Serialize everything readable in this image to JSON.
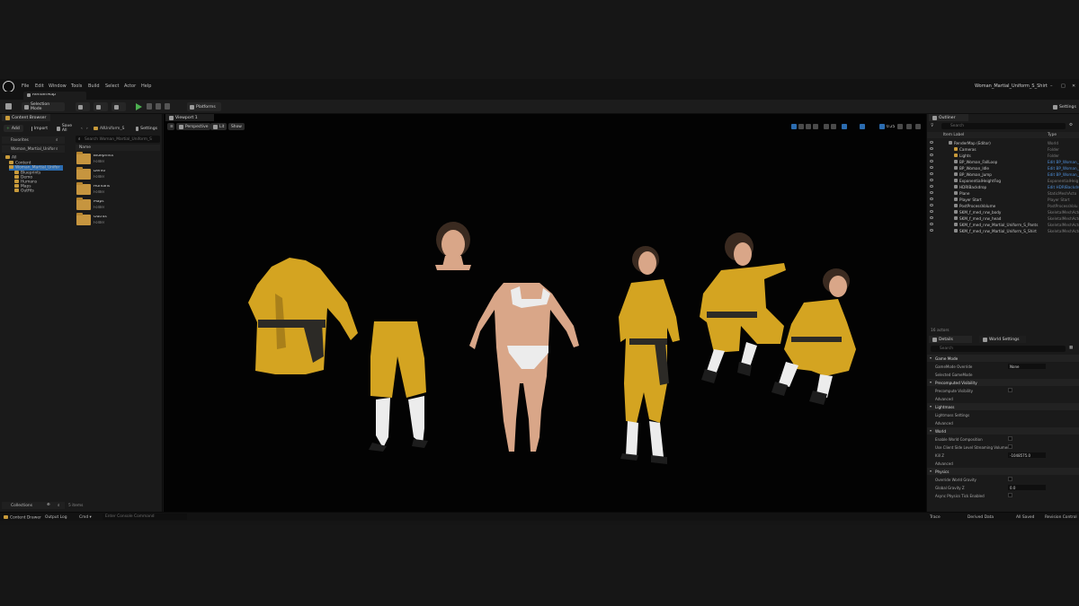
{
  "menu": [
    "File",
    "Edit",
    "Window",
    "Tools",
    "Build",
    "Select",
    "Actor",
    "Help"
  ],
  "map_tab": "RenderMap",
  "window_title": "Woman_Martial_Uniform_S_Shirt",
  "window_controls": [
    "–",
    "□",
    "✕"
  ],
  "toolbar": {
    "mode": "Selection Mode",
    "platforms": "Platforms",
    "settings": "Settings"
  },
  "content_browser": {
    "tab": "Content Browser",
    "add": "Add",
    "import": "Import",
    "save_all": "Save All",
    "path_root": "All",
    "path": "Uniform_S",
    "settings": "Settings",
    "favorites": "Favorites",
    "project_folder": "Woman_Martial_Unifor",
    "search_placeholder": "Search Woman_Martial_Uniform_S",
    "tree": [
      "All",
      "Content",
      "Woman_Martial_Unifor",
      "Blueprints",
      "Demo",
      "Humans",
      "Maps",
      "Outfits"
    ],
    "column_name": "Name",
    "items": [
      {
        "name": "Blueprints",
        "type": "Folder"
      },
      {
        "name": "Demo",
        "type": "Folder"
      },
      {
        "name": "Humans",
        "type": "Folder"
      },
      {
        "name": "Maps",
        "type": "Folder"
      },
      {
        "name": "Outfits",
        "type": "Folder"
      }
    ],
    "item_count": "5 items",
    "collections": "Collections"
  },
  "viewport": {
    "tab": "Viewport 1",
    "perspective": "Perspective",
    "lit": "Lit",
    "show": "Show",
    "snap_value": "0.25"
  },
  "outliner": {
    "tab": "Outliner",
    "search_placeholder": "Search",
    "col_label": "Item Label",
    "col_type": "Type",
    "rows": [
      {
        "label": "RenderMap (Editor)",
        "type": "World",
        "indent": 0,
        "link": false,
        "folder": false
      },
      {
        "label": "Cameras",
        "type": "Folder",
        "indent": 1,
        "link": false,
        "folder": true
      },
      {
        "label": "Lights",
        "type": "Folder",
        "indent": 1,
        "link": false,
        "folder": true
      },
      {
        "label": "BP_Woman_FallLoop",
        "type": "Edit BP_Woman_F",
        "indent": 1,
        "link": true,
        "folder": false
      },
      {
        "label": "BP_Woman_Idle",
        "type": "Edit BP_Woman_I",
        "indent": 1,
        "link": true,
        "folder": false
      },
      {
        "label": "BP_Woman_Jump",
        "type": "Edit BP_Woman_J",
        "indent": 1,
        "link": true,
        "folder": false
      },
      {
        "label": "ExponentialHeightFog",
        "type": "ExponentialHeig",
        "indent": 1,
        "link": false,
        "folder": false
      },
      {
        "label": "HDRIBackdrop",
        "type": "Edit HDRIBackdro",
        "indent": 1,
        "link": true,
        "folder": false
      },
      {
        "label": "Plane",
        "type": "StaticMeshActo",
        "indent": 1,
        "link": false,
        "folder": false
      },
      {
        "label": "Player Start",
        "type": "Player Start",
        "indent": 1,
        "link": false,
        "folder": false
      },
      {
        "label": "PostProcessVolume",
        "type": "PostProcessVolu",
        "indent": 1,
        "link": false,
        "folder": false
      },
      {
        "label": "SKM_f_med_nrw_body",
        "type": "SkeletalMeshActo",
        "indent": 1,
        "link": false,
        "folder": false
      },
      {
        "label": "SKM_f_med_nrw_head",
        "type": "SkeletalMeshActo",
        "indent": 1,
        "link": false,
        "folder": false
      },
      {
        "label": "SKM_f_med_nrw_Martial_Uniform_S_Pants",
        "type": "SkeletalMeshActo",
        "indent": 1,
        "link": false,
        "folder": false
      },
      {
        "label": "SKM_f_med_nrw_Martial_Uniform_S_Shirt",
        "type": "SkeletalMeshActo",
        "indent": 1,
        "link": false,
        "folder": false
      }
    ],
    "actor_count": "16 actors"
  },
  "details": {
    "tab_details": "Details",
    "tab_world": "World Settings",
    "search_placeholder": "Search",
    "rows": [
      {
        "kind": "section",
        "text": "Game Mode"
      },
      {
        "kind": "row",
        "text": "GameMode Override",
        "value": "None"
      },
      {
        "kind": "row",
        "text": "Selected GameMode",
        "value": ""
      },
      {
        "kind": "section",
        "text": "Precomputed Visibility"
      },
      {
        "kind": "row",
        "text": "Precompute Visibility",
        "value": "check"
      },
      {
        "kind": "row",
        "text": "Advanced",
        "value": ""
      },
      {
        "kind": "section",
        "text": "Lightmass"
      },
      {
        "kind": "row",
        "text": "Lightmass Settings",
        "value": ""
      },
      {
        "kind": "row",
        "text": "Advanced",
        "value": ""
      },
      {
        "kind": "section",
        "text": "World"
      },
      {
        "kind": "row",
        "text": "Enable World Composition",
        "value": "check"
      },
      {
        "kind": "row",
        "text": "Use Client Side Level Streaming Volumes",
        "value": "check"
      },
      {
        "kind": "row",
        "text": "Kill Z",
        "value": "-1048575.0"
      },
      {
        "kind": "row",
        "text": "Advanced",
        "value": ""
      },
      {
        "kind": "section",
        "text": "Physics"
      },
      {
        "kind": "row",
        "text": "Override World Gravity",
        "value": "check"
      },
      {
        "kind": "row",
        "text": "Global Gravity Z",
        "value": "0.0"
      },
      {
        "kind": "row",
        "text": "Async Physics Tick Enabled",
        "value": "check"
      }
    ]
  },
  "status": {
    "content_drawer": "Content Drawer",
    "output_log": "Output Log",
    "cmd": "Cmd",
    "console_placeholder": "Enter Console Command",
    "trace": "Trace",
    "derived_data": "Derived Data",
    "all_saved": "All Saved",
    "revision_control": "Revision Control"
  },
  "colors": {
    "accent_blue": "#2b6cb0",
    "folder": "#c89a3a",
    "uniform_yellow": "#d4a421",
    "play_green": "#4caf50"
  }
}
